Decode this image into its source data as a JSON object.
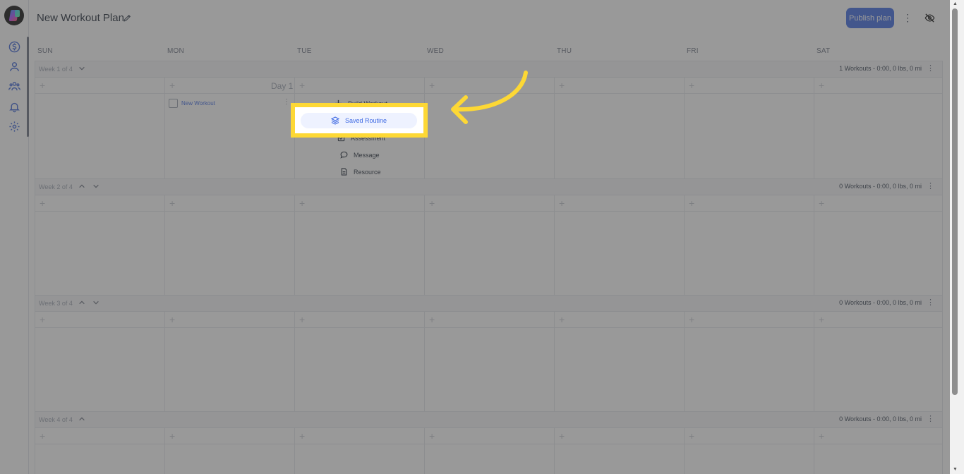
{
  "header": {
    "title": "New Workout Plan",
    "publish_label": "Publish plan",
    "more_icon": "more-vertical-icon",
    "visibility_icon": "eye-off-icon"
  },
  "sidebar": {
    "items": [
      {
        "name": "billing",
        "icon": "dollar-icon"
      },
      {
        "name": "profile",
        "icon": "user-icon"
      },
      {
        "name": "clients",
        "icon": "users-icon"
      },
      {
        "name": "notifications",
        "icon": "bell-icon"
      },
      {
        "name": "settings",
        "icon": "gear-icon"
      }
    ]
  },
  "calendar": {
    "days": [
      "SUN",
      "MON",
      "TUE",
      "WED",
      "THU",
      "FRI",
      "SAT"
    ],
    "weeks": [
      {
        "label": "Week 1 of 4",
        "summary": "1 Workouts - 0:00, 0 lbs, 0 mi"
      },
      {
        "label": "Week 2 of 4",
        "summary": "0 Workouts - 0:00, 0 lbs, 0 mi"
      },
      {
        "label": "Week 3 of 4",
        "summary": "0 Workouts - 0:00, 0 lbs, 0 mi"
      },
      {
        "label": "Week 4 of 4",
        "summary": "0 Workouts - 0:00, 0 lbs, 0 mi"
      }
    ],
    "day_label": "Day 1",
    "workout": {
      "name": "New Workout"
    }
  },
  "menu": {
    "items": [
      {
        "label": "Build Workout",
        "icon": "plus-icon"
      },
      {
        "label": "Saved Routine",
        "icon": "layers-icon"
      },
      {
        "label": "Assessment",
        "icon": "checklist-icon"
      },
      {
        "label": "Message",
        "icon": "message-icon"
      },
      {
        "label": "Resource",
        "icon": "document-icon"
      }
    ],
    "highlighted": "Saved Routine"
  },
  "theme": {
    "accent": "#3f6ae3",
    "highlight": "#fdd835",
    "overlay": "rgba(70,70,70,0.55)"
  }
}
